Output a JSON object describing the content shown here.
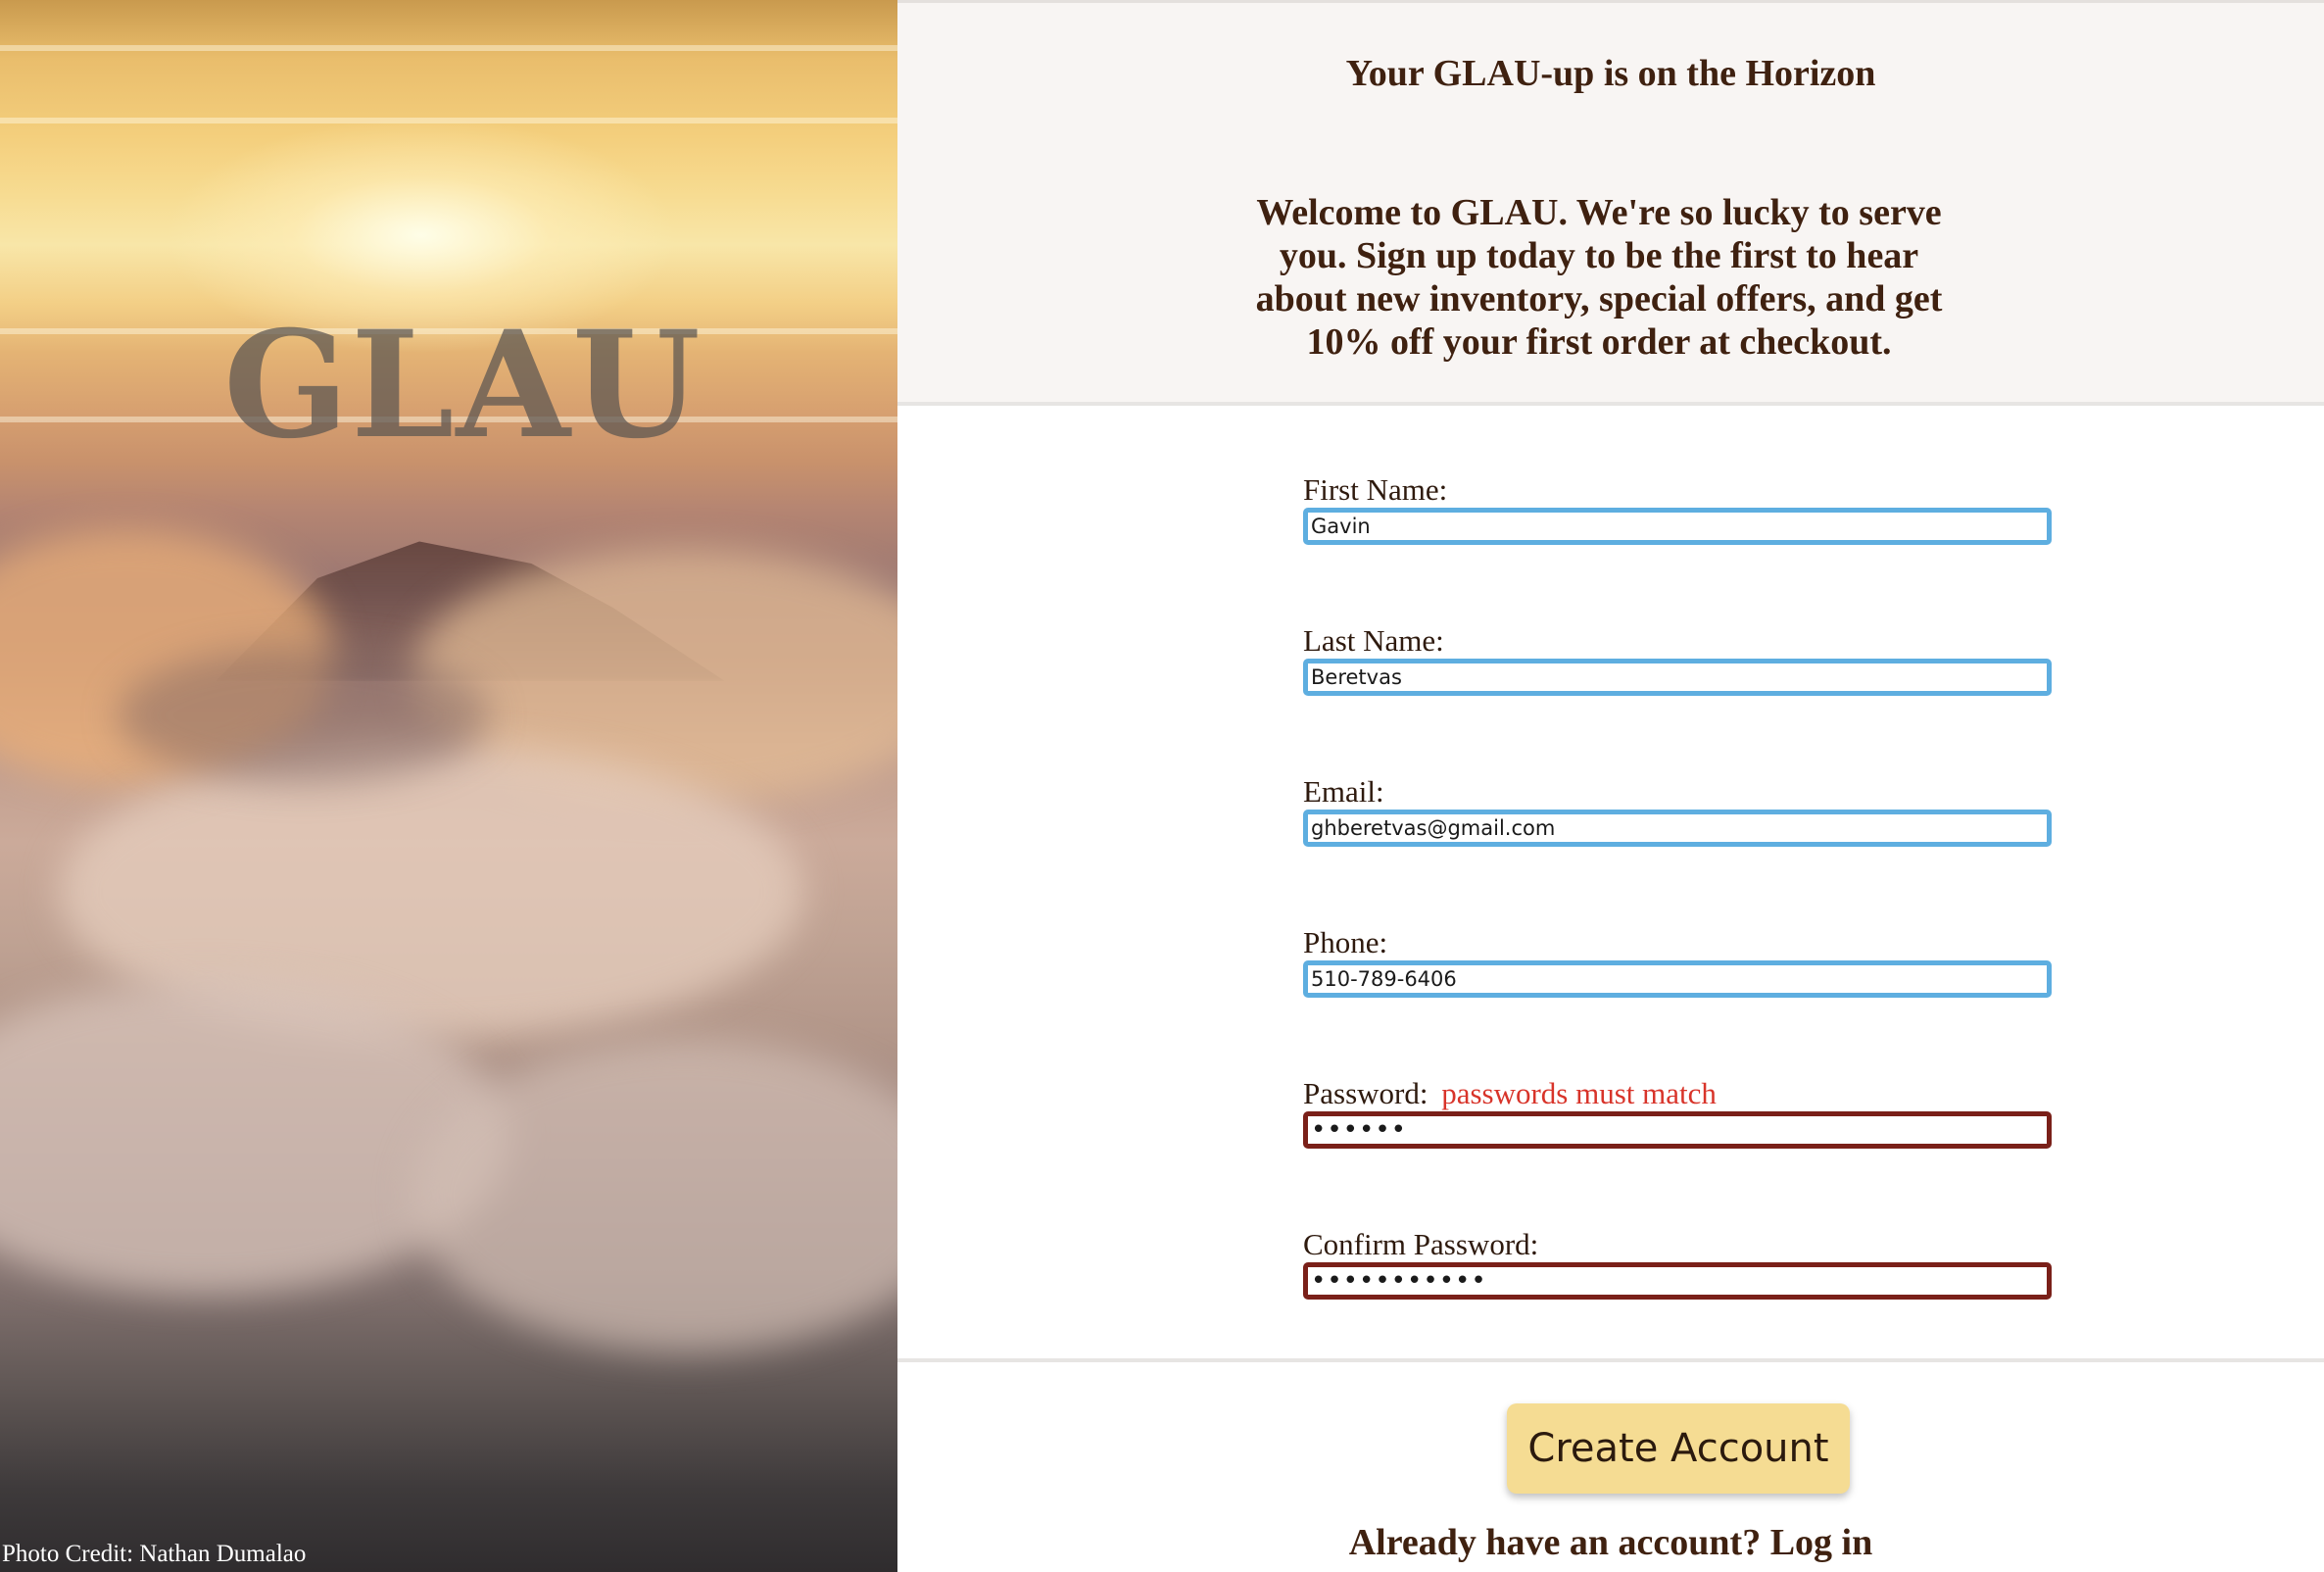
{
  "hero": {
    "logo": "GLAU",
    "photo_credit": "Photo Credit: Nathan Dumalao"
  },
  "header": {
    "tagline": "Your GLAU-up is on the Horizon",
    "welcome": "Welcome to GLAU. We're so lucky to serve you. Sign up today to be the first to hear about new inventory, special offers, and get 10% off your first order at checkout."
  },
  "form": {
    "first_name": {
      "label": "First Name:",
      "value": "Gavin"
    },
    "last_name": {
      "label": "Last Name:",
      "value": "Beretvas"
    },
    "email": {
      "label": "Email:",
      "value": "ghberetvas@gmail.com"
    },
    "phone": {
      "label": "Phone:",
      "value": "510-789-6406"
    },
    "password": {
      "label": "Password:",
      "error": "passwords must match",
      "value": "abcdef"
    },
    "confirm_password": {
      "label": "Confirm Password:",
      "value": "abcdefghijk"
    }
  },
  "actions": {
    "create_account_label": "Create Account",
    "login_prompt": "Already have an account?",
    "login_link": "Log in"
  },
  "colors": {
    "heading_text": "#3f2110",
    "valid_border": "#5eaee0",
    "invalid_border": "#7a2019",
    "error_text": "#d8342a",
    "button_bg": "#f5dc93"
  }
}
